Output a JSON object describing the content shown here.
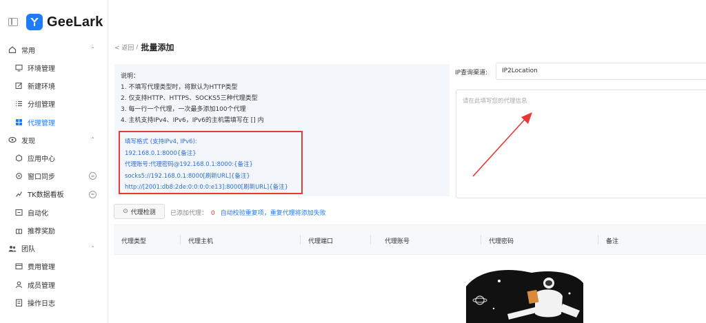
{
  "app": {
    "name": "GeeLark"
  },
  "sidebar": {
    "groups": [
      {
        "label": "常用",
        "items": [
          {
            "label": "环境管理",
            "icon": "monitor-icon"
          },
          {
            "label": "新建环境",
            "icon": "edit-icon"
          },
          {
            "label": "分组管理",
            "icon": "list-icon"
          },
          {
            "label": "代理管理",
            "icon": "proxy-icon",
            "active": true
          }
        ]
      },
      {
        "label": "发现",
        "items": [
          {
            "label": "应用中心",
            "icon": "apps-icon"
          },
          {
            "label": "窗口同步",
            "icon": "sync-icon"
          },
          {
            "label": "TK数据看板",
            "icon": "chart-icon"
          },
          {
            "label": "自动化",
            "icon": "automation-icon"
          },
          {
            "label": "推荐奖励",
            "icon": "gift-icon"
          }
        ]
      },
      {
        "label": "团队",
        "items": [
          {
            "label": "费用管理",
            "icon": "wallet-icon"
          },
          {
            "label": "成员管理",
            "icon": "user-icon"
          },
          {
            "label": "操作日志",
            "icon": "log-icon"
          }
        ]
      }
    ]
  },
  "breadcrumb": {
    "back": "< 返回",
    "sep": "/",
    "title": "批量添加"
  },
  "instructions": {
    "heading": "说明：",
    "lines": [
      "1. 不填写代理类型时，将默认为HTTP类型",
      "2. 仅支持HTTP、HTTPS、SOCKS5三种代理类型",
      "3. 每一行一个代理，一次最多添加100个代理",
      "4. 主机支持IPv4、IPv6，IPv6的主机需填写在 [] 内"
    ],
    "format": [
      "填写格式 (支持IPv4, IPv6):",
      "192.168.0.1:8000{备注}",
      "代理账号:代理密码@192.168.0.1:8000:{备注}",
      "socks5://192.168.0.1:8000[刷新URL]{备注}",
      "http://[2001:db8:2de:0:0:0:0:e13]:8000[刷新URL]{备注}"
    ]
  },
  "ip_query": {
    "label": "IP查询渠道:",
    "value": "IP2Location"
  },
  "proxy_input": {
    "placeholder": "请在此填写您的代理信息"
  },
  "toolbar": {
    "check_label": "代理检测",
    "added_label": "已添加代理：",
    "added_count": "0",
    "dedupe_note": "自动校验重复项，重复代理将添加失败"
  },
  "table": {
    "columns": [
      "代理类型",
      "代理主机",
      "代理端口",
      "代理账号",
      "代理密码",
      "备注"
    ]
  },
  "colors": {
    "accent": "#1f7cf9",
    "highlight_border": "#e53935",
    "format_text": "#2b6fd6"
  }
}
